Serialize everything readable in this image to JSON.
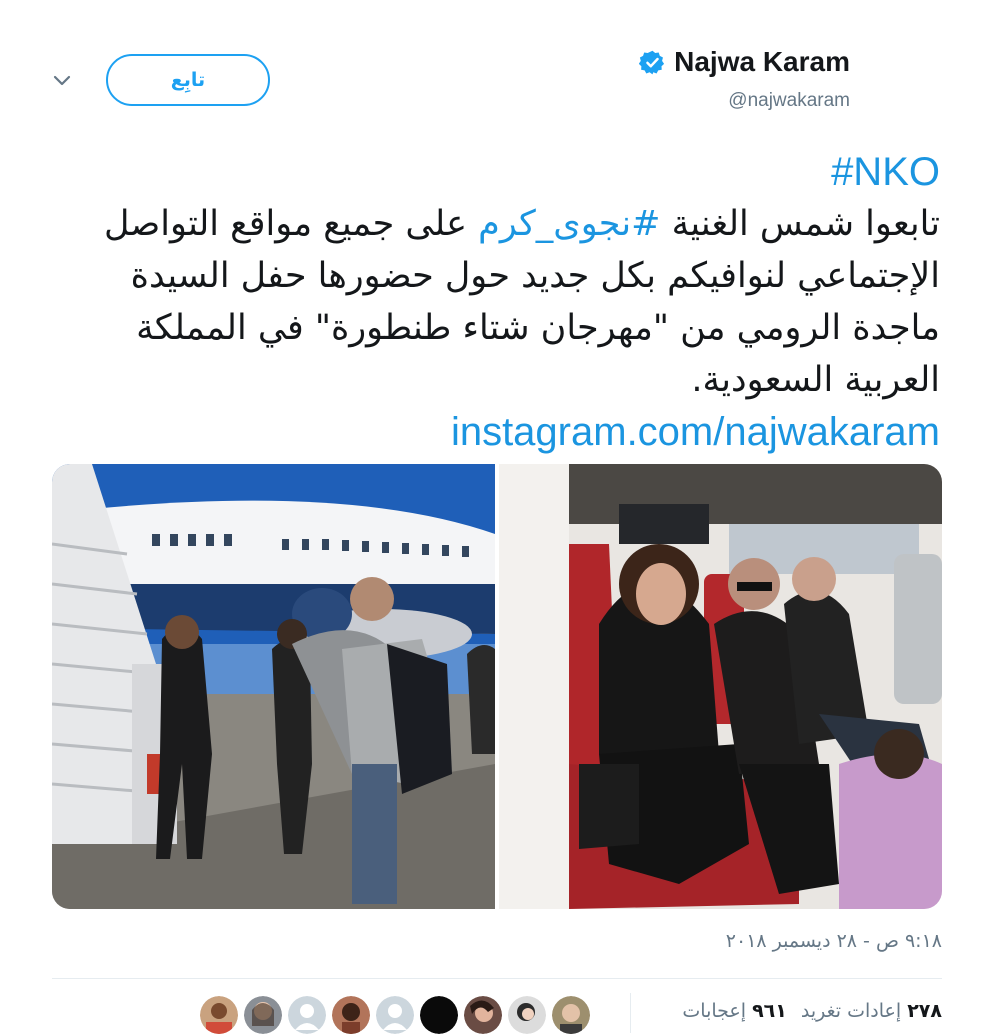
{
  "header": {
    "display_name": "Najwa Karam",
    "handle": "@najwakaram",
    "follow_label": "تابِع"
  },
  "tweet": {
    "hashtag_top": "#NKO",
    "line1_before": "تابعوا شمس الغنية ",
    "hashtag_inline": "#نجوى_كرم",
    "line1_after": " على جميع مواقع التواصل الإجتماعي لنوافيكم بكل جديد حول حضورها حفل السيدة ماجدة الرومي من \"مهرجان شتاء طنطورة\" في المملكة العربية السعودية.",
    "link": "instagram.com/najwakaram"
  },
  "timestamp": "٩:١٨ ص - ٢٨ ديسمبر ٢٠١٨",
  "stats": {
    "retweets_count": "٢٧٨",
    "retweets_label": "إعادات تغريد",
    "likes_count": "٩٦١",
    "likes_label": "إعجابات"
  },
  "colors": {
    "accent": "#1da1f2",
    "link": "#1b95e0",
    "text": "#14171a",
    "muted": "#657786"
  }
}
